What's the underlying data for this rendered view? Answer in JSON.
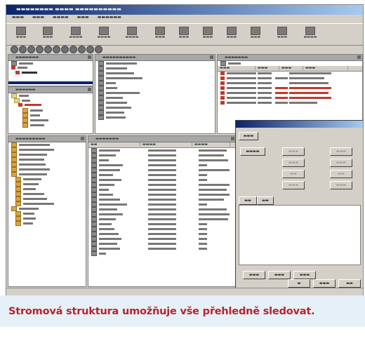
{
  "caption": "Stromová struktura umožňuje vše přehledně sledovat."
}
